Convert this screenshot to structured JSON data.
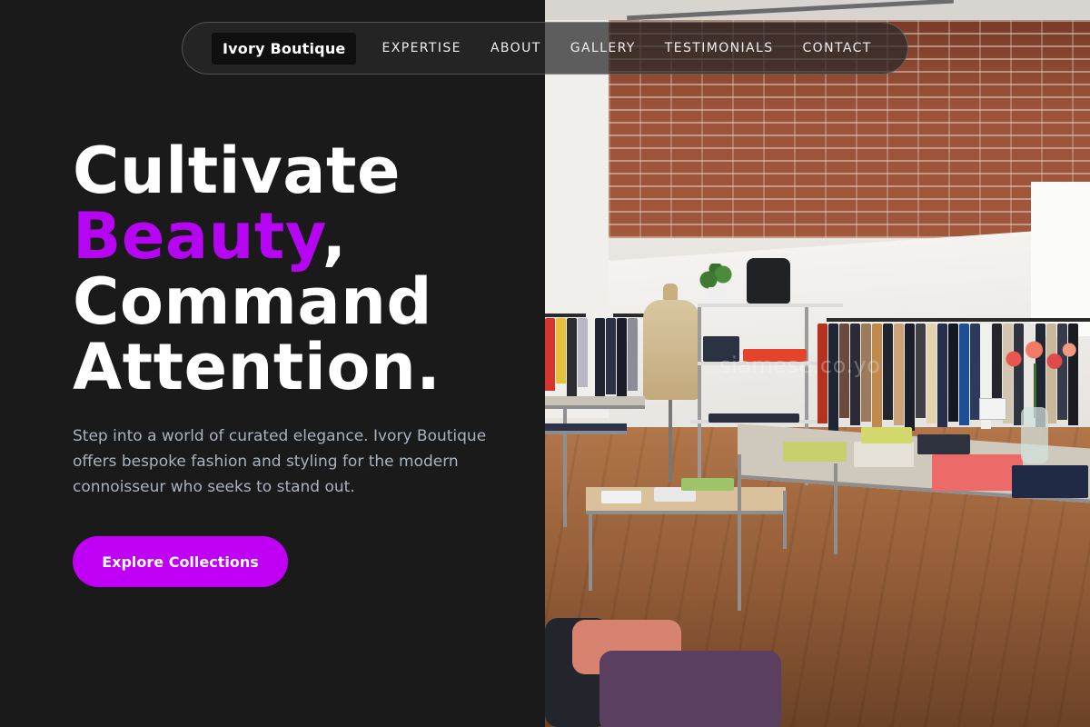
{
  "nav": {
    "brand": "Ivory Boutique",
    "links": [
      "EXPERTISE",
      "ABOUT",
      "GALLERY",
      "TESTIMONIALS",
      "CONTACT"
    ]
  },
  "hero": {
    "title_line1": "Cultivate",
    "title_accent": "Beauty",
    "title_comma": ",",
    "title_line3": "Command",
    "title_line4": "Attention.",
    "description": "Step into a world of curated elegance. Ivory Boutique offers bespoke fashion and styling for the modern connoisseur who seeks to stand out.",
    "cta_label": "Explore Collections"
  },
  "image": {
    "watermark": "siamese.co.yo"
  },
  "colors": {
    "background": "#1a1a1b",
    "accent": "#b505f2",
    "button": "#c000f5",
    "body_text": "#a9b2bf"
  }
}
